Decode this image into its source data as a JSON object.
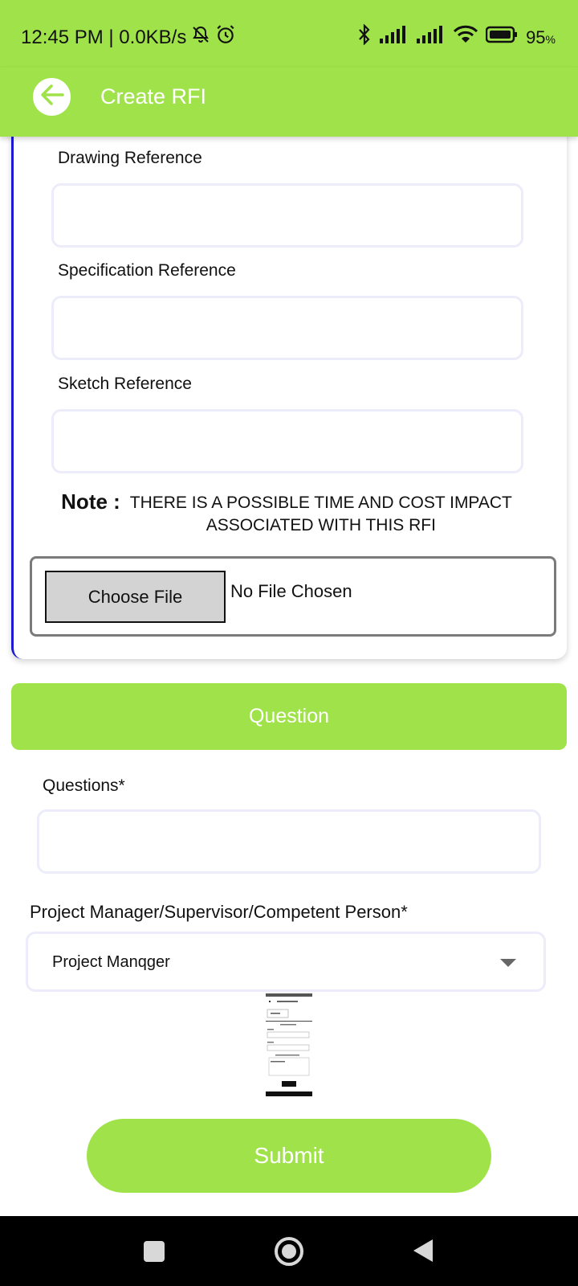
{
  "status_bar": {
    "time": "12:45 PM | 0.0KB/s",
    "battery": "95"
  },
  "app_bar": {
    "title": "Create RFI"
  },
  "form": {
    "drawing_reference_label": "Drawing Reference",
    "specification_reference_label": "Specification Reference",
    "sketch_reference_label": "Sketch Reference",
    "note_prefix": "Note :",
    "note_text": "THERE IS A POSSIBLE TIME AND COST IMPACT ASSOCIATED WITH THIS RFI",
    "choose_file_label": "Choose File",
    "no_file_text": "No File Chosen"
  },
  "question_section": {
    "header": "Question",
    "questions_label": "Questions*",
    "assignee_label": "Project Manager/Supervisor/Competent Person*",
    "assignee_value": "Project Manqger"
  },
  "submit_label": "Submit",
  "icons": [
    "mute-icon",
    "alarm-icon",
    "bluetooth-icon",
    "signal-icon",
    "wifi-icon",
    "battery-icon",
    "back-arrow-icon",
    "caret-down-icon",
    "nav-recents-icon",
    "nav-home-icon",
    "nav-back-icon"
  ],
  "colors": {
    "accent": "#a0e249",
    "card_border": "#1a1ad6"
  }
}
